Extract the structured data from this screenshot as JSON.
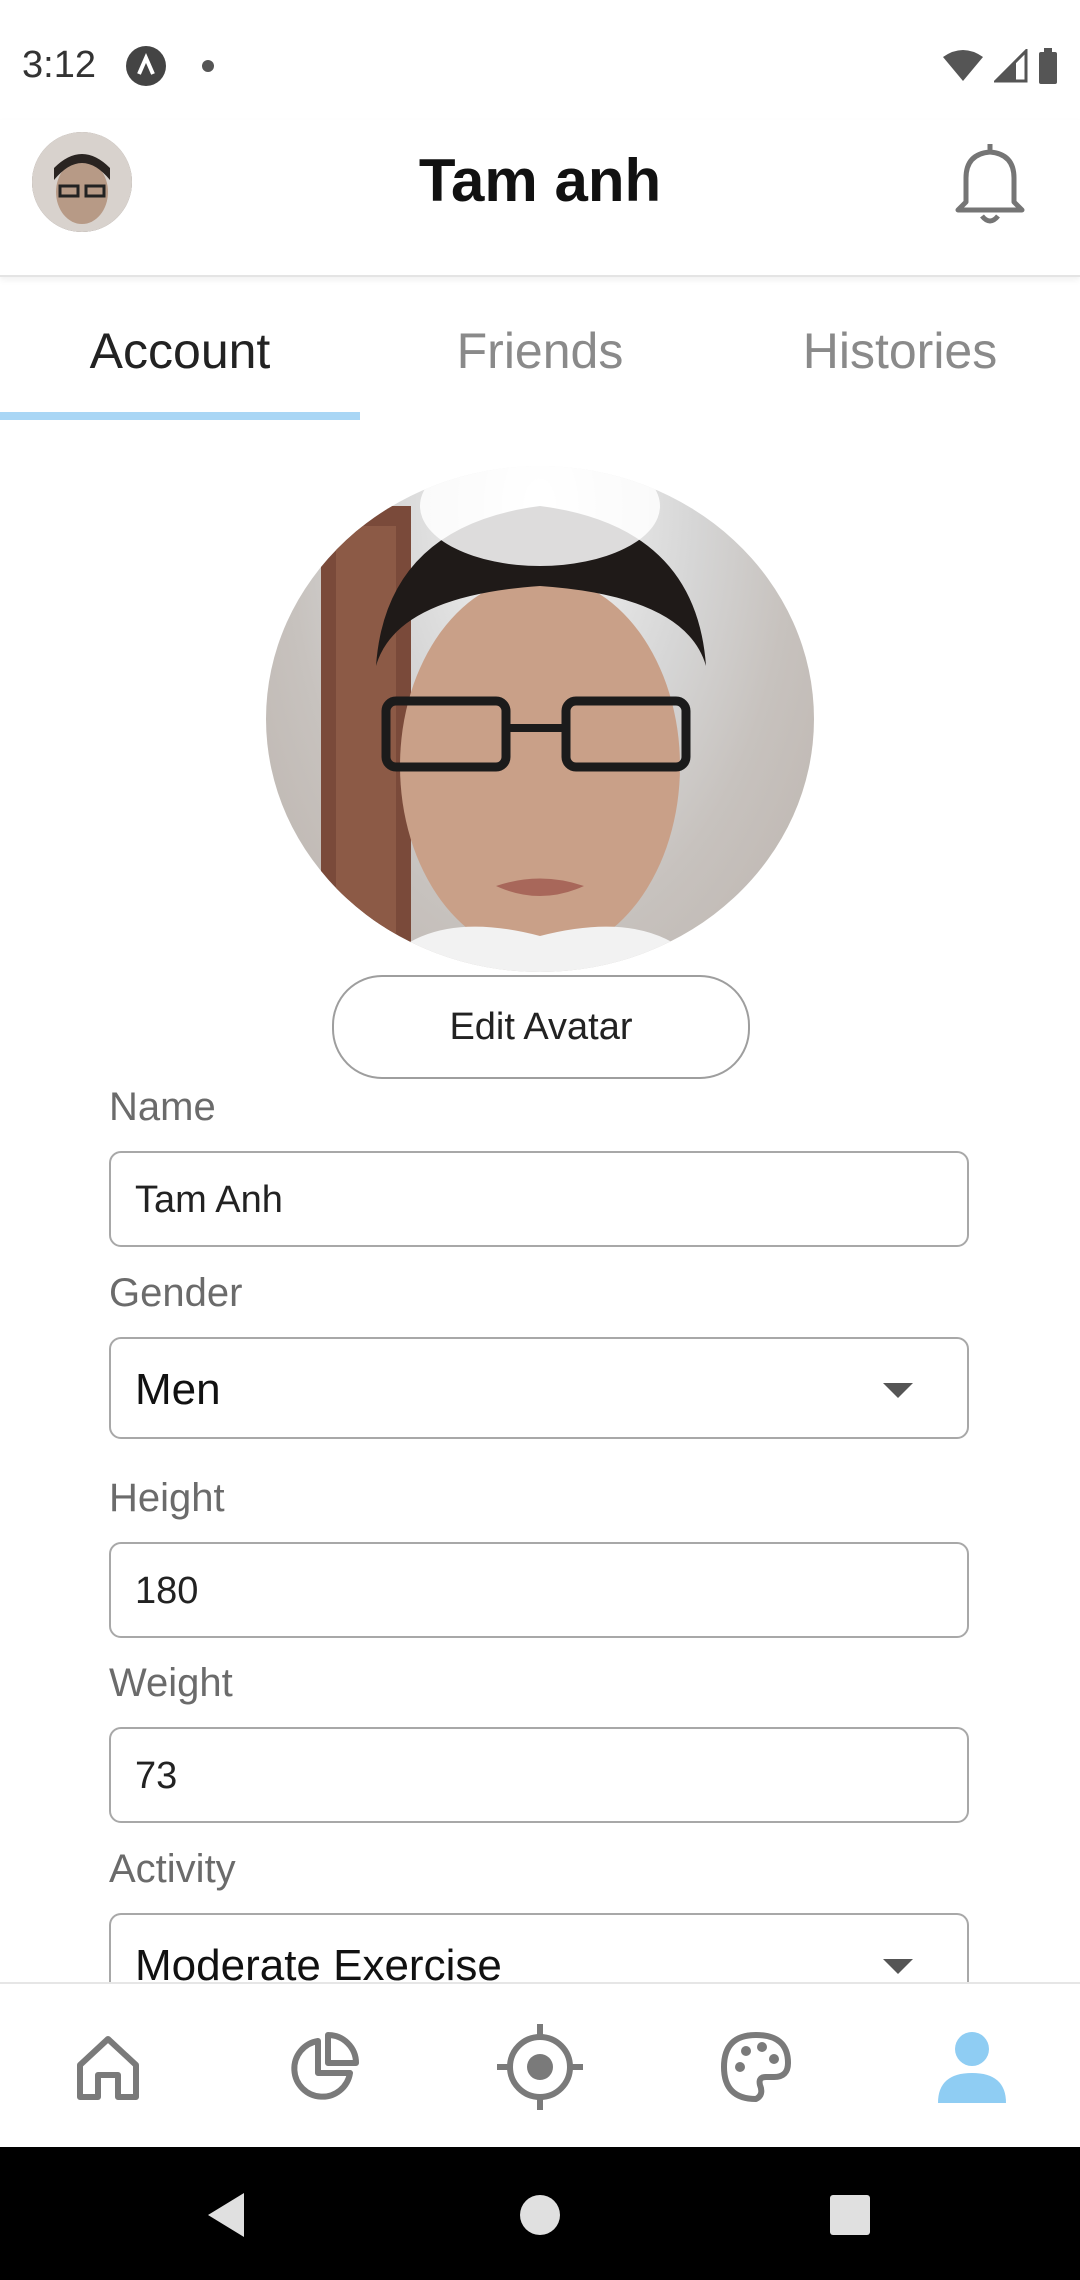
{
  "status_bar": {
    "time": "3:12"
  },
  "header": {
    "title": "Tam anh"
  },
  "tabs": [
    {
      "label": "Account",
      "active": true
    },
    {
      "label": "Friends",
      "active": false
    },
    {
      "label": "Histories",
      "active": false
    }
  ],
  "profile": {
    "edit_avatar_label": "Edit Avatar"
  },
  "form": {
    "name": {
      "label": "Name",
      "value": "Tam Anh"
    },
    "gender": {
      "label": "Gender",
      "value": "Men"
    },
    "height": {
      "label": "Height",
      "value": "180"
    },
    "weight": {
      "label": "Weight",
      "value": "73"
    },
    "activity": {
      "label": "Activity",
      "value": "Moderate Exercise"
    }
  },
  "bottom_nav": {
    "items": [
      {
        "icon": "home-icon",
        "active": false
      },
      {
        "icon": "pie-chart-icon",
        "active": false
      },
      {
        "icon": "target-icon",
        "active": false
      },
      {
        "icon": "palette-icon",
        "active": false
      },
      {
        "icon": "user-icon",
        "active": true
      }
    ],
    "active_color": "#8fcdf3",
    "inactive_color": "#7a7a7a"
  }
}
